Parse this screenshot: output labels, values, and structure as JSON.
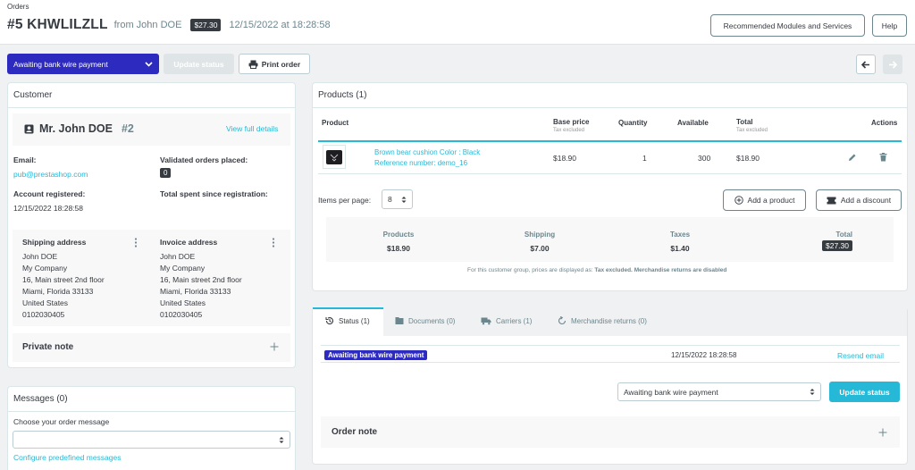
{
  "header": {
    "breadcrumb": "Orders",
    "order_ref": "#5 KHWLILZLL",
    "from_text": "from John DOE",
    "total_badge": "$27.30",
    "date_text": "12/15/2022 at 18:28:58",
    "recommended_label": "Recommended Modules and Services",
    "help_label": "Help"
  },
  "toolbar": {
    "status_value": "Awaiting bank wire payment",
    "update_status_label": "Update status",
    "print_label": "Print order"
  },
  "customer": {
    "title": "Customer",
    "name": "Mr. John DOE",
    "id": "#2",
    "view_details": "View full details",
    "email_label": "Email:",
    "email_value": "pub@prestashop.com",
    "validated_label": "Validated orders placed:",
    "validated_value": "0",
    "registered_label": "Account registered:",
    "registered_value": "12/15/2022 18:28:58",
    "spent_label": "Total spent since registration:",
    "shipping_title": "Shipping address",
    "shipping_lines": [
      "John DOE",
      "My Company",
      "16, Main street 2nd floor",
      "Miami, Florida 33133",
      "United States",
      "0102030405"
    ],
    "invoice_title": "Invoice address",
    "invoice_lines": [
      "John DOE",
      "My Company",
      "16, Main street 2nd floor",
      "Miami, Florida 33133",
      "United States",
      "0102030405"
    ],
    "private_note": "Private note"
  },
  "messages": {
    "title": "Messages (0)",
    "choose_label": "Choose your order message",
    "configure_link": "Configure predefined messages"
  },
  "products": {
    "title": "Products (1)",
    "col_product": "Product",
    "col_base_price": "Base price",
    "col_base_price_sub": "Tax excluded",
    "col_quantity": "Quantity",
    "col_available": "Available",
    "col_total": "Total",
    "col_total_sub": "Tax excluded",
    "col_actions": "Actions",
    "row": {
      "name": "Brown bear cushion Color : Black",
      "reference": "Reference number: demo_16",
      "base_price": "$18.90",
      "quantity": "1",
      "available": "300",
      "total": "$18.90"
    },
    "items_per_page_label": "Items per page:",
    "items_per_page_value": "8",
    "add_product_label": "Add a product",
    "add_discount_label": "Add a discount",
    "summary": {
      "products_label": "Products",
      "products_value": "$18.90",
      "shipping_label": "Shipping",
      "shipping_value": "$7.00",
      "taxes_label": "Taxes",
      "taxes_value": "$1.40",
      "total_label": "Total",
      "total_value": "$27.30"
    },
    "footnote_prefix": "For this customer group, prices are displayed as:",
    "footnote_tax": "Tax excluded.",
    "footnote_returns": "Merchandise returns are disabled"
  },
  "tabs": {
    "status": "Status (1)",
    "documents": "Documents (0)",
    "carriers": "Carriers (1)",
    "returns": "Merchandise returns (0)",
    "history_status": "Awaiting bank wire payment",
    "history_date": "12/15/2022 18:28:58",
    "resend_email": "Resend email",
    "select_value": "Awaiting bank wire payment",
    "update_label": "Update status",
    "order_note": "Order note"
  },
  "colors": {
    "accent": "#25b9d7",
    "status": "#2d2abf",
    "dark": "#363a41"
  }
}
